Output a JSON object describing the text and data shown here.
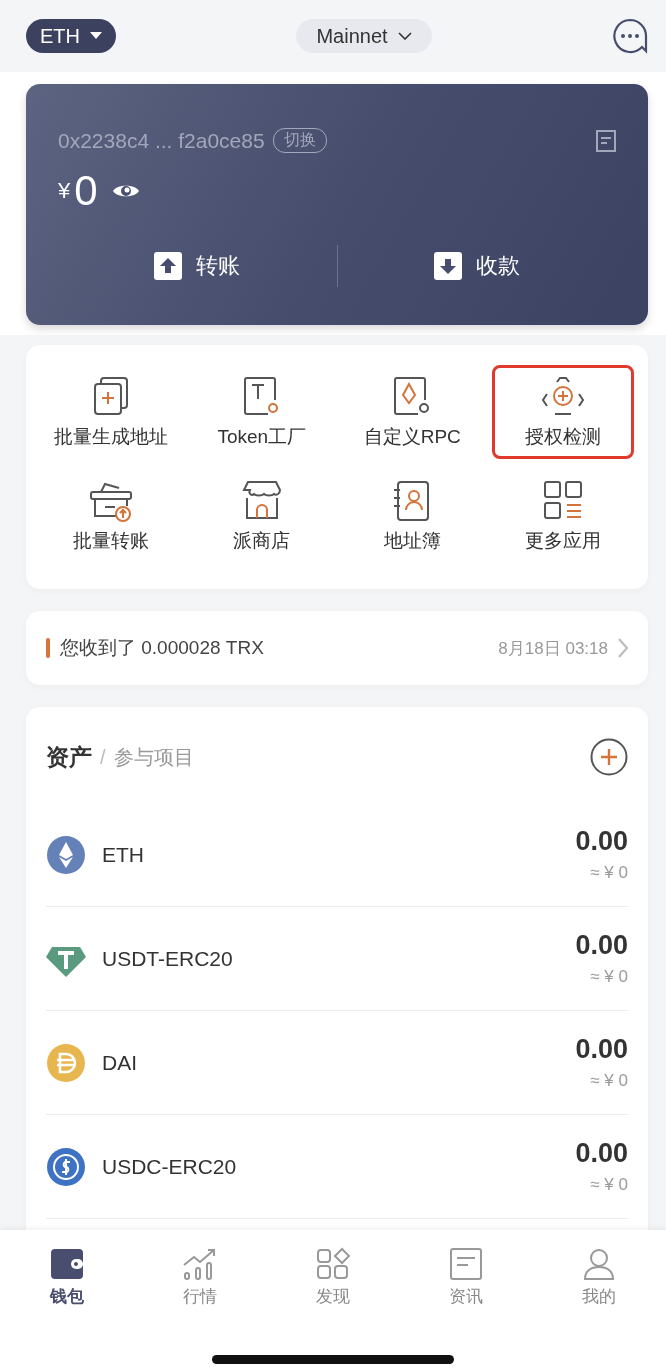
{
  "header": {
    "chain": "ETH",
    "network": "Mainnet"
  },
  "wallet": {
    "address": "0x2238c4 ... f2a0ce85",
    "switch_label": "切换",
    "currency": "¥",
    "balance": "0",
    "actions": [
      "转账",
      "收款"
    ]
  },
  "apps": [
    {
      "label": "批量生成地址",
      "highlighted": false
    },
    {
      "label": "Token工厂",
      "highlighted": false
    },
    {
      "label": "自定义RPC",
      "highlighted": false
    },
    {
      "label": "授权检测",
      "highlighted": true
    },
    {
      "label": "批量转账",
      "highlighted": false
    },
    {
      "label": "派商店",
      "highlighted": false
    },
    {
      "label": "地址簿",
      "highlighted": false
    },
    {
      "label": "更多应用",
      "highlighted": false
    }
  ],
  "notice": {
    "text": "您收到了 0.000028 TRX",
    "time": "8月18日 03:18"
  },
  "assets": {
    "separator": "/",
    "tabs": [
      {
        "label": "资产",
        "selected": true
      },
      {
        "label": "参与项目",
        "selected": false
      }
    ],
    "rows": [
      {
        "symbol": "ETH",
        "color": "#6481b8",
        "amount": "0.00",
        "value": "≈ ¥ 0"
      },
      {
        "symbol": "USDT-ERC20",
        "color": "#5a9a7e",
        "amount": "0.00",
        "value": "≈ ¥ 0"
      },
      {
        "symbol": "DAI",
        "color": "#e8b64f",
        "amount": "0.00",
        "value": "≈ ¥ 0"
      },
      {
        "symbol": "USDC-ERC20",
        "color": "#3e73c4",
        "amount": "0.00",
        "value": "≈ ¥ 0"
      }
    ]
  },
  "tab_bar": [
    {
      "label": "钱包",
      "selected": true
    },
    {
      "label": "行情",
      "selected": false
    },
    {
      "label": "发现",
      "selected": false
    },
    {
      "label": "资讯",
      "selected": false
    },
    {
      "label": "我的",
      "selected": false
    }
  ]
}
